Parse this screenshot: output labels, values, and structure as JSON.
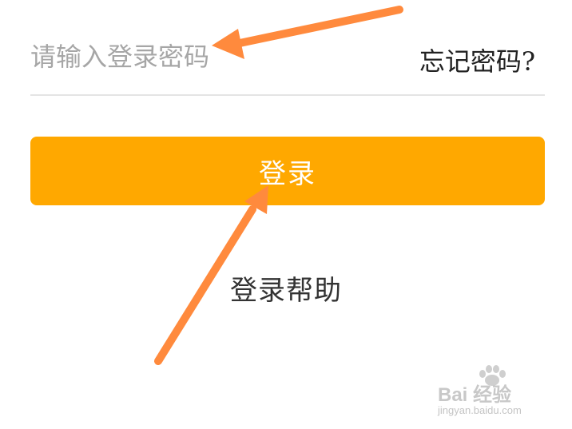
{
  "password_field": {
    "placeholder": "请输入登录密码",
    "value": ""
  },
  "forgot_password_label": "忘记密码?",
  "login_button_label": "登录",
  "login_help_label": "登录帮助",
  "watermark": {
    "logo_text": "Bai 经验",
    "url": "jingyan.baidu.com"
  },
  "colors": {
    "login_button": "#ffa800",
    "annotation_arrow": "#ff8a3d"
  }
}
